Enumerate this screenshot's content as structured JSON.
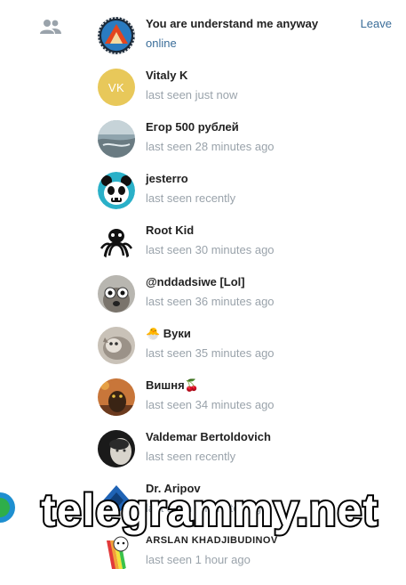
{
  "header": {
    "leave_label": "Leave"
  },
  "members": [
    {
      "name": "You are understand me anyway",
      "status": "online",
      "online": true
    },
    {
      "name": "Vitaly K",
      "status": "last seen just now",
      "initials": "VK"
    },
    {
      "name": "Егор 500 рублей",
      "status": "last seen 28 minutes ago"
    },
    {
      "name": "jesterro",
      "status": "last seen recently"
    },
    {
      "name": "Root Kid",
      "status": "last seen 30 minutes ago"
    },
    {
      "name": "@nddadsiwe [Lol]",
      "status": "last seen 36 minutes ago"
    },
    {
      "name": "🐣 Вуки",
      "status": "last seen 35 minutes ago"
    },
    {
      "name": "Вишня🍒",
      "status": "last seen 34 minutes ago"
    },
    {
      "name": "Valdemar Bertoldovich",
      "status": "last seen recently"
    },
    {
      "name": "Dr. Aripov",
      "status": "last seen 8 minutes ago"
    },
    {
      "name": "ARSLAN KHADJIBUDINOV",
      "status": "last seen 1 hour ago"
    }
  ],
  "watermark": {
    "text": "telegrammy.net"
  },
  "colors": {
    "link": "#3a6d99",
    "status": "#9aa3ab",
    "vk_avatar": "#e8c85a"
  }
}
